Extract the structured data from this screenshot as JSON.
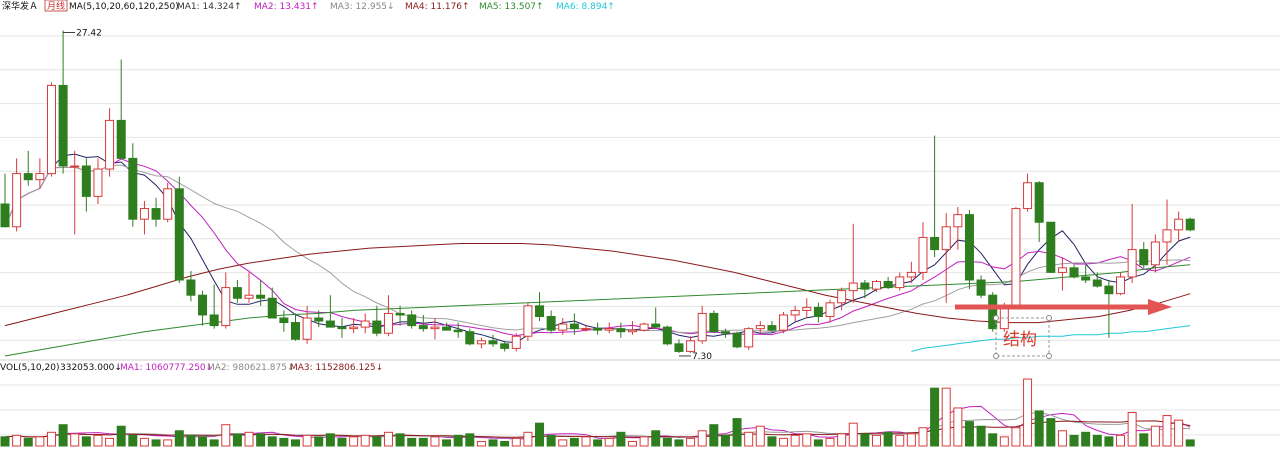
{
  "header": {
    "stock_name": "深华发Ａ",
    "period": "月线",
    "ma_label": "MA(5,10,20,60,120,250)",
    "ma_items": [
      {
        "label": "MA1: 14.324↑",
        "color": "#333333"
      },
      {
        "label": "MA2: 13.431↑",
        "color": "#c020c0"
      },
      {
        "label": "MA3: 12.955↓",
        "color": "#888888"
      },
      {
        "label": "MA4: 11.176↑",
        "color": "#8b1a1a"
      },
      {
        "label": "MA5: 13.507↑",
        "color": "#2e8b2e"
      },
      {
        "label": "MA6: 8.894↑",
        "color": "#20c8d8"
      }
    ]
  },
  "vol_header": {
    "label": "VOL(5,10,20)",
    "value": "332053.000↓",
    "items": [
      {
        "label": "MA1: 1060777.250↓",
        "color": "#c020c0"
      },
      {
        "label": "MA2: 980621.875↓",
        "color": "#888888"
      },
      {
        "label": "MA3: 1152806.125↓",
        "color": "#8b1a1a"
      }
    ]
  },
  "annotations": {
    "high_label": "27.42",
    "low_label": "7.30",
    "structure_label": "结构"
  },
  "colors": {
    "up": "#d83a3a",
    "down": "#2e7d1e",
    "grid": "#e4e4e4",
    "arrow": "#e35555"
  },
  "chart_data": {
    "type": "candlestick",
    "y_range": [
      6.0,
      28.5
    ],
    "candles": [
      {
        "o": 16.0,
        "h": 18.0,
        "l": 14.5,
        "c": 14.5
      },
      {
        "o": 14.5,
        "h": 19.0,
        "l": 14.2,
        "c": 18.0
      },
      {
        "o": 18.0,
        "h": 19.5,
        "l": 17.2,
        "c": 17.6
      },
      {
        "o": 17.6,
        "h": 19.0,
        "l": 17.0,
        "c": 18.0
      },
      {
        "o": 18.0,
        "h": 24.0,
        "l": 17.8,
        "c": 23.8
      },
      {
        "o": 23.8,
        "h": 27.42,
        "l": 18.0,
        "c": 18.5
      },
      {
        "o": 18.5,
        "h": 19.5,
        "l": 14.0,
        "c": 18.5
      },
      {
        "o": 18.5,
        "h": 19.0,
        "l": 15.5,
        "c": 16.5
      },
      {
        "o": 16.5,
        "h": 19.0,
        "l": 16.0,
        "c": 18.3
      },
      {
        "o": 18.3,
        "h": 22.3,
        "l": 17.8,
        "c": 21.5
      },
      {
        "o": 21.5,
        "h": 25.5,
        "l": 19.0,
        "c": 19.0
      },
      {
        "o": 19.0,
        "h": 20.0,
        "l": 14.5,
        "c": 15.0
      },
      {
        "o": 15.0,
        "h": 16.2,
        "l": 14.0,
        "c": 15.7
      },
      {
        "o": 15.7,
        "h": 16.4,
        "l": 14.5,
        "c": 15.0
      },
      {
        "o": 15.0,
        "h": 17.4,
        "l": 14.8,
        "c": 17.0
      },
      {
        "o": 17.0,
        "h": 17.8,
        "l": 10.8,
        "c": 11.0
      },
      {
        "o": 11.0,
        "h": 11.6,
        "l": 9.6,
        "c": 10.0
      },
      {
        "o": 10.0,
        "h": 10.3,
        "l": 8.0,
        "c": 8.7
      },
      {
        "o": 8.7,
        "h": 10.7,
        "l": 7.8,
        "c": 8.0
      },
      {
        "o": 8.0,
        "h": 11.5,
        "l": 7.8,
        "c": 10.5
      },
      {
        "o": 10.5,
        "h": 11.0,
        "l": 9.5,
        "c": 9.8
      },
      {
        "o": 9.8,
        "h": 11.5,
        "l": 9.5,
        "c": 10.0
      },
      {
        "o": 10.0,
        "h": 11.0,
        "l": 9.3,
        "c": 9.8
      },
      {
        "o": 9.8,
        "h": 10.5,
        "l": 8.5,
        "c": 8.5
      },
      {
        "o": 8.5,
        "h": 9.0,
        "l": 7.6,
        "c": 8.2
      },
      {
        "o": 8.2,
        "h": 8.8,
        "l": 7.0,
        "c": 7.1
      },
      {
        "o": 7.1,
        "h": 9.3,
        "l": 6.8,
        "c": 8.5
      },
      {
        "o": 8.5,
        "h": 9.0,
        "l": 7.9,
        "c": 8.3
      },
      {
        "o": 8.3,
        "h": 10.0,
        "l": 7.9,
        "c": 7.9
      },
      {
        "o": 7.9,
        "h": 8.5,
        "l": 7.2,
        "c": 7.8
      },
      {
        "o": 7.8,
        "h": 8.5,
        "l": 7.5,
        "c": 7.9
      },
      {
        "o": 7.9,
        "h": 8.8,
        "l": 7.5,
        "c": 8.3
      },
      {
        "o": 8.3,
        "h": 9.3,
        "l": 7.3,
        "c": 7.5
      },
      {
        "o": 7.5,
        "h": 10.0,
        "l": 7.3,
        "c": 8.8
      },
      {
        "o": 8.8,
        "h": 9.3,
        "l": 8.0,
        "c": 8.7
      },
      {
        "o": 8.7,
        "h": 9.0,
        "l": 7.8,
        "c": 8.0
      },
      {
        "o": 8.0,
        "h": 8.7,
        "l": 7.6,
        "c": 7.8
      },
      {
        "o": 7.8,
        "h": 8.5,
        "l": 7.1,
        "c": 7.9
      },
      {
        "o": 7.9,
        "h": 8.2,
        "l": 7.7,
        "c": 7.7
      },
      {
        "o": 7.7,
        "h": 8.2,
        "l": 7.2,
        "c": 7.6
      },
      {
        "o": 7.6,
        "h": 7.8,
        "l": 6.7,
        "c": 6.8
      },
      {
        "o": 6.8,
        "h": 7.2,
        "l": 6.5,
        "c": 7.0
      },
      {
        "o": 7.0,
        "h": 7.4,
        "l": 6.6,
        "c": 6.8
      },
      {
        "o": 6.8,
        "h": 7.0,
        "l": 6.3,
        "c": 6.5
      },
      {
        "o": 6.5,
        "h": 7.5,
        "l": 6.3,
        "c": 7.3
      },
      {
        "o": 7.3,
        "h": 9.5,
        "l": 7.0,
        "c": 9.3
      },
      {
        "o": 9.3,
        "h": 10.2,
        "l": 8.3,
        "c": 8.6
      },
      {
        "o": 8.6,
        "h": 9.0,
        "l": 7.5,
        "c": 7.7
      },
      {
        "o": 7.7,
        "h": 8.5,
        "l": 7.4,
        "c": 8.1
      },
      {
        "o": 8.1,
        "h": 8.8,
        "l": 7.4,
        "c": 7.8
      },
      {
        "o": 7.8,
        "h": 8.0,
        "l": 7.6,
        "c": 7.8
      },
      {
        "o": 7.8,
        "h": 8.2,
        "l": 7.4,
        "c": 7.7
      },
      {
        "o": 7.7,
        "h": 8.2,
        "l": 7.5,
        "c": 7.8
      },
      {
        "o": 7.8,
        "h": 8.2,
        "l": 7.2,
        "c": 7.6
      },
      {
        "o": 7.6,
        "h": 8.3,
        "l": 7.4,
        "c": 7.7
      },
      {
        "o": 7.7,
        "h": 8.2,
        "l": 7.6,
        "c": 8.1
      },
      {
        "o": 8.1,
        "h": 9.2,
        "l": 7.9,
        "c": 7.9
      },
      {
        "o": 7.9,
        "h": 8.0,
        "l": 6.7,
        "c": 6.8
      },
      {
        "o": 6.8,
        "h": 7.1,
        "l": 6.2,
        "c": 6.3
      },
      {
        "o": 6.3,
        "h": 7.3,
        "l": 6.2,
        "c": 7.0
      },
      {
        "o": 7.0,
        "h": 9.3,
        "l": 6.8,
        "c": 8.8
      },
      {
        "o": 8.8,
        "h": 9.0,
        "l": 7.5,
        "c": 7.6
      },
      {
        "o": 7.6,
        "h": 7.8,
        "l": 7.2,
        "c": 7.5
      },
      {
        "o": 7.5,
        "h": 7.6,
        "l": 6.5,
        "c": 6.6
      },
      {
        "o": 6.6,
        "h": 7.9,
        "l": 6.4,
        "c": 7.8
      },
      {
        "o": 7.8,
        "h": 8.3,
        "l": 7.4,
        "c": 8.0
      },
      {
        "o": 8.0,
        "h": 8.3,
        "l": 7.6,
        "c": 7.7
      },
      {
        "o": 7.7,
        "h": 8.9,
        "l": 7.5,
        "c": 8.7
      },
      {
        "o": 8.7,
        "h": 9.3,
        "l": 8.3,
        "c": 9.0
      },
      {
        "o": 9.0,
        "h": 9.8,
        "l": 8.5,
        "c": 9.2
      },
      {
        "o": 9.2,
        "h": 9.5,
        "l": 8.2,
        "c": 8.6
      },
      {
        "o": 8.6,
        "h": 9.7,
        "l": 8.2,
        "c": 9.5
      },
      {
        "o": 9.5,
        "h": 10.5,
        "l": 9.0,
        "c": 10.3
      },
      {
        "o": 10.3,
        "h": 14.7,
        "l": 9.5,
        "c": 10.8
      },
      {
        "o": 10.8,
        "h": 11.0,
        "l": 9.8,
        "c": 10.4
      },
      {
        "o": 10.4,
        "h": 11.0,
        "l": 10.2,
        "c": 10.9
      },
      {
        "o": 10.9,
        "h": 11.2,
        "l": 10.4,
        "c": 10.5
      },
      {
        "o": 10.5,
        "h": 11.5,
        "l": 10.3,
        "c": 11.2
      },
      {
        "o": 11.2,
        "h": 12.2,
        "l": 10.8,
        "c": 11.5
      },
      {
        "o": 11.5,
        "h": 14.8,
        "l": 11.0,
        "c": 13.8
      },
      {
        "o": 13.8,
        "h": 20.5,
        "l": 12.5,
        "c": 13.0
      },
      {
        "o": 13.0,
        "h": 15.4,
        "l": 9.5,
        "c": 14.5
      },
      {
        "o": 14.5,
        "h": 15.8,
        "l": 13.0,
        "c": 15.3
      },
      {
        "o": 15.3,
        "h": 15.6,
        "l": 10.4,
        "c": 11.0
      },
      {
        "o": 11.0,
        "h": 11.3,
        "l": 9.8,
        "c": 10.0
      },
      {
        "o": 10.0,
        "h": 10.2,
        "l": 7.6,
        "c": 7.8
      },
      {
        "o": 7.8,
        "h": 9.5,
        "l": 7.6,
        "c": 9.3
      },
      {
        "o": 9.3,
        "h": 15.8,
        "l": 9.2,
        "c": 15.7
      },
      {
        "o": 15.7,
        "h": 18.0,
        "l": 15.5,
        "c": 17.4
      },
      {
        "o": 17.4,
        "h": 17.5,
        "l": 13.5,
        "c": 14.8
      },
      {
        "o": 14.8,
        "h": 14.8,
        "l": 11.5,
        "c": 11.5
      },
      {
        "o": 11.5,
        "h": 12.5,
        "l": 10.3,
        "c": 11.8
      },
      {
        "o": 11.8,
        "h": 12.0,
        "l": 11.1,
        "c": 11.2
      },
      {
        "o": 11.2,
        "h": 12.0,
        "l": 10.8,
        "c": 11.0
      },
      {
        "o": 11.0,
        "h": 11.5,
        "l": 10.5,
        "c": 10.6
      },
      {
        "o": 10.6,
        "h": 11.0,
        "l": 7.2,
        "c": 10.1
      },
      {
        "o": 10.1,
        "h": 11.5,
        "l": 10.0,
        "c": 11.2
      },
      {
        "o": 11.2,
        "h": 16.0,
        "l": 10.8,
        "c": 13.0
      },
      {
        "o": 13.0,
        "h": 13.5,
        "l": 11.8,
        "c": 12.0
      },
      {
        "o": 12.0,
        "h": 14.0,
        "l": 11.5,
        "c": 13.5
      },
      {
        "o": 13.5,
        "h": 16.3,
        "l": 12.0,
        "c": 14.3
      },
      {
        "o": 14.3,
        "h": 15.5,
        "l": 13.5,
        "c": 15.0
      },
      {
        "o": 15.0,
        "h": 15.1,
        "l": 14.2,
        "c": 14.3
      }
    ],
    "volume_range": [
      0,
      4600000
    ],
    "volumes": [
      600000,
      700000,
      500000,
      600000,
      900000,
      1400000,
      800000,
      600000,
      700000,
      500000,
      1300000,
      700000,
      500000,
      400000,
      400000,
      1000000,
      700000,
      600000,
      400000,
      1400000,
      800000,
      900000,
      800000,
      600000,
      500000,
      400000,
      700000,
      600000,
      800000,
      500000,
      600000,
      700000,
      600000,
      900000,
      800000,
      500000,
      500000,
      600000,
      400000,
      700000,
      800000,
      300000,
      400000,
      300000,
      500000,
      900000,
      1500000,
      700000,
      400000,
      500000,
      600000,
      400000,
      500000,
      900000,
      300000,
      600000,
      1000000,
      500000,
      400000,
      500000,
      1000000,
      1400000,
      700000,
      1800000,
      900000,
      1300000,
      600000,
      500000,
      700000,
      800000,
      400000,
      500000,
      800000,
      1500000,
      800000,
      700000,
      900000,
      700000,
      800000,
      1200000,
      3800000,
      3800000,
      2500000,
      1600000,
      1300000,
      800000,
      600000,
      1200000,
      4400000,
      2300000,
      1800000,
      1000000,
      700000,
      900000,
      700000,
      600000,
      700000,
      2200000,
      800000,
      1300000,
      2000000,
      1700000,
      400000
    ],
    "ma_lines": [
      {
        "name": "MA1",
        "period": 5,
        "color": "#222266"
      },
      {
        "name": "MA2",
        "period": 10,
        "color": "#c020c0"
      },
      {
        "name": "MA3",
        "period": 20,
        "color": "#a0a0a0"
      },
      {
        "name": "MA4",
        "period": 60,
        "color": "#8b1a1a"
      },
      {
        "name": "MA5",
        "period": 120,
        "color": "#2e8b2e"
      },
      {
        "name": "MA6",
        "period": 250,
        "color": "#20c8d8"
      }
    ],
    "ma_values_extra": {
      "MA4": [
        8.0,
        8.5,
        9.0,
        9.5,
        10.0,
        10.6,
        11.2,
        11.7,
        12.1,
        12.4,
        12.7,
        12.9,
        13.1,
        13.2,
        13.3,
        13.4,
        13.4,
        13.4,
        13.3,
        13.1,
        12.9,
        12.6,
        12.3,
        11.9,
        11.5,
        11.0,
        10.5,
        10.0,
        9.6,
        9.2,
        8.8,
        8.5,
        8.3,
        8.2,
        8.2,
        8.4,
        8.6,
        9.0,
        9.5,
        10.1
      ],
      "MA5": [
        6.0,
        6.4,
        6.8,
        7.2,
        7.6,
        7.9,
        8.2,
        8.5,
        8.7,
        8.8,
        9.0,
        9.1,
        9.2,
        9.3,
        9.4,
        9.5,
        9.6,
        9.7,
        9.8,
        9.9,
        10.0,
        10.1,
        10.2,
        10.3,
        10.4,
        10.5,
        10.6,
        10.7,
        10.8,
        10.9,
        11.1,
        11.3,
        11.5,
        11.8,
        12.0
      ],
      "MA6": [
        6.3,
        6.5,
        6.6,
        6.7,
        6.8,
        6.9,
        7.0,
        7.1,
        7.1,
        7.2,
        7.2,
        7.3,
        7.3,
        7.3,
        7.4,
        7.4,
        7.4,
        7.5,
        7.5,
        7.6,
        7.6,
        7.7,
        7.8,
        7.9,
        8.0
      ]
    }
  }
}
